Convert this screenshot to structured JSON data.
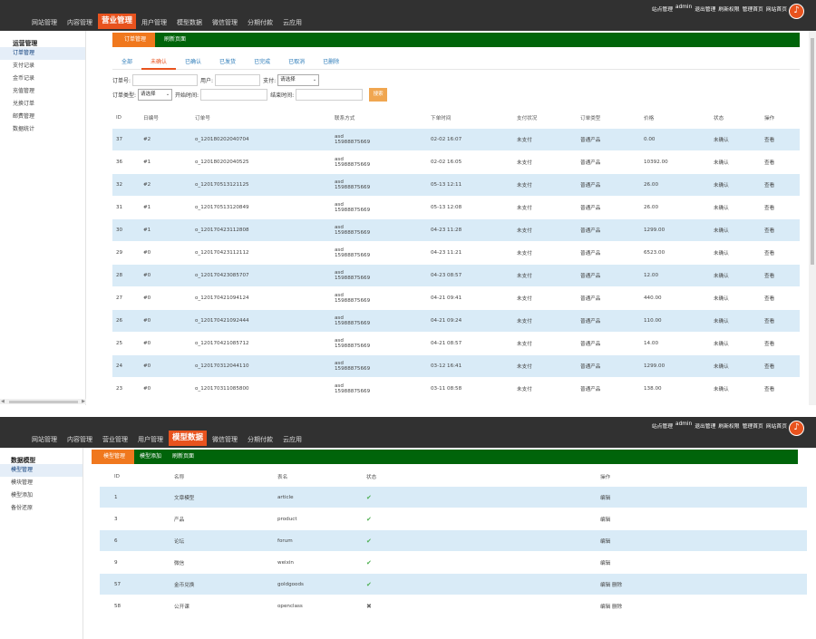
{
  "top": {
    "nav": [
      "网站管理",
      "内容管理",
      "营业管理",
      "用户管理",
      "模型数据",
      "微信管理",
      "分期付款",
      "云应用"
    ],
    "links": [
      "站点管理",
      "admin",
      "退出管理",
      "刷新权限",
      "管理首页",
      "网站首页"
    ],
    "music_icon": "♪"
  },
  "shotA": {
    "active_nav": "营业管理",
    "sidebar": {
      "title": "运营管理",
      "items": [
        "订单管理",
        "支付记录",
        "金币记录",
        "充值管理",
        "兑换订单",
        "邮费管理",
        "数据统计"
      ]
    },
    "tabs": [
      "订单管理",
      "刷新页面"
    ],
    "subtabs": [
      "全部",
      "未确认",
      "已确认",
      "已发货",
      "已完成",
      "已取消",
      "已删除"
    ],
    "filters": {
      "order_no": "订单号:",
      "user": "用户:",
      "pay": "支付:",
      "pay_value": "请选择",
      "order_type": "订单类型:",
      "order_type_value": "请选择",
      "start_time": "开始时间:",
      "end_time": "结束时间:",
      "search": "搜索"
    },
    "columns": [
      "ID",
      "日编号",
      "订单号",
      "联系方式",
      "下单时间",
      "支付状况",
      "订单类型",
      "价格",
      "状态",
      "操作"
    ],
    "rows": [
      {
        "id": "37",
        "num": "#2",
        "order": "o_120180202040704",
        "contact1": "asd",
        "contact2": "15988875669",
        "time": "02-02 16:07",
        "pay": "未支付",
        "type": "普通产品",
        "price": "0.00",
        "status": "未确认",
        "op": "查看"
      },
      {
        "id": "36",
        "num": "#1",
        "order": "o_120180202040525",
        "contact1": "asd",
        "contact2": "15988875669",
        "time": "02-02 16:05",
        "pay": "未支付",
        "type": "普通产品",
        "price": "10392.00",
        "status": "未确认",
        "op": "查看"
      },
      {
        "id": "32",
        "num": "#2",
        "order": "o_120170513121125",
        "contact1": "asd",
        "contact2": "15988875669",
        "time": "05-13 12:11",
        "pay": "未支付",
        "type": "普通产品",
        "price": "26.00",
        "status": "未确认",
        "op": "查看"
      },
      {
        "id": "31",
        "num": "#1",
        "order": "o_120170513120849",
        "contact1": "asd",
        "contact2": "15988875669",
        "time": "05-13 12:08",
        "pay": "未支付",
        "type": "普通产品",
        "price": "26.00",
        "status": "未确认",
        "op": "查看"
      },
      {
        "id": "30",
        "num": "#1",
        "order": "o_120170423112808",
        "contact1": "asd",
        "contact2": "15988875669",
        "time": "04-23 11:28",
        "pay": "未支付",
        "type": "普通产品",
        "price": "1299.00",
        "status": "未确认",
        "op": "查看"
      },
      {
        "id": "29",
        "num": "#0",
        "order": "o_120170423112112",
        "contact1": "asd",
        "contact2": "15988875669",
        "time": "04-23 11:21",
        "pay": "未支付",
        "type": "普通产品",
        "price": "6523.00",
        "status": "未确认",
        "op": "查看"
      },
      {
        "id": "28",
        "num": "#0",
        "order": "o_120170423085707",
        "contact1": "asd",
        "contact2": "15988875669",
        "time": "04-23 08:57",
        "pay": "未支付",
        "type": "普通产品",
        "price": "12.00",
        "status": "未确认",
        "op": "查看"
      },
      {
        "id": "27",
        "num": "#0",
        "order": "o_120170421094124",
        "contact1": "asd",
        "contact2": "15988875669",
        "time": "04-21 09:41",
        "pay": "未支付",
        "type": "普通产品",
        "price": "440.00",
        "status": "未确认",
        "op": "查看"
      },
      {
        "id": "26",
        "num": "#0",
        "order": "o_120170421092444",
        "contact1": "asd",
        "contact2": "15988875669",
        "time": "04-21 09:24",
        "pay": "未支付",
        "type": "普通产品",
        "price": "110.00",
        "status": "未确认",
        "op": "查看"
      },
      {
        "id": "25",
        "num": "#0",
        "order": "o_120170421085712",
        "contact1": "asd",
        "contact2": "15988875669",
        "time": "04-21 08:57",
        "pay": "未支付",
        "type": "普通产品",
        "price": "14.00",
        "status": "未确认",
        "op": "查看"
      },
      {
        "id": "24",
        "num": "#0",
        "order": "o_120170312044110",
        "contact1": "asd",
        "contact2": "15988875669",
        "time": "03-12 16:41",
        "pay": "未支付",
        "type": "普通产品",
        "price": "1299.00",
        "status": "未确认",
        "op": "查看"
      },
      {
        "id": "23",
        "num": "#0",
        "order": "o_120170311085800",
        "contact1": "asd",
        "contact2": "15988875669",
        "time": "03-11 08:58",
        "pay": "未支付",
        "type": "普通产品",
        "price": "138.00",
        "status": "未确认",
        "op": "查看"
      }
    ]
  },
  "shotB": {
    "active_nav": "模型数据",
    "sidebar": {
      "title": "数据模型",
      "items": [
        "模型管理",
        "模块管理",
        "模型添加",
        "备份还原"
      ]
    },
    "tabs": [
      "模型管理",
      "模型添加",
      "刷新页面"
    ],
    "columns": [
      "ID",
      "名称",
      "表名",
      "状态",
      "操作"
    ],
    "rows": [
      {
        "id": "1",
        "name": "文章模型",
        "table": "article",
        "ok": true,
        "ops": "编辑"
      },
      {
        "id": "3",
        "name": "产品",
        "table": "product",
        "ok": true,
        "ops": "编辑"
      },
      {
        "id": "6",
        "name": "论坛",
        "table": "forum",
        "ok": true,
        "ops": "编辑"
      },
      {
        "id": "9",
        "name": "微信",
        "table": "weixin",
        "ok": true,
        "ops": "编辑"
      },
      {
        "id": "57",
        "name": "金币兑换",
        "table": "goldgoods",
        "ok": true,
        "ops": "编辑 删除"
      },
      {
        "id": "58",
        "name": "公开课",
        "table": "openclass",
        "ok": false,
        "ops": "编辑 删除"
      }
    ],
    "check_icon": "✔",
    "cross_icon": "✖"
  }
}
